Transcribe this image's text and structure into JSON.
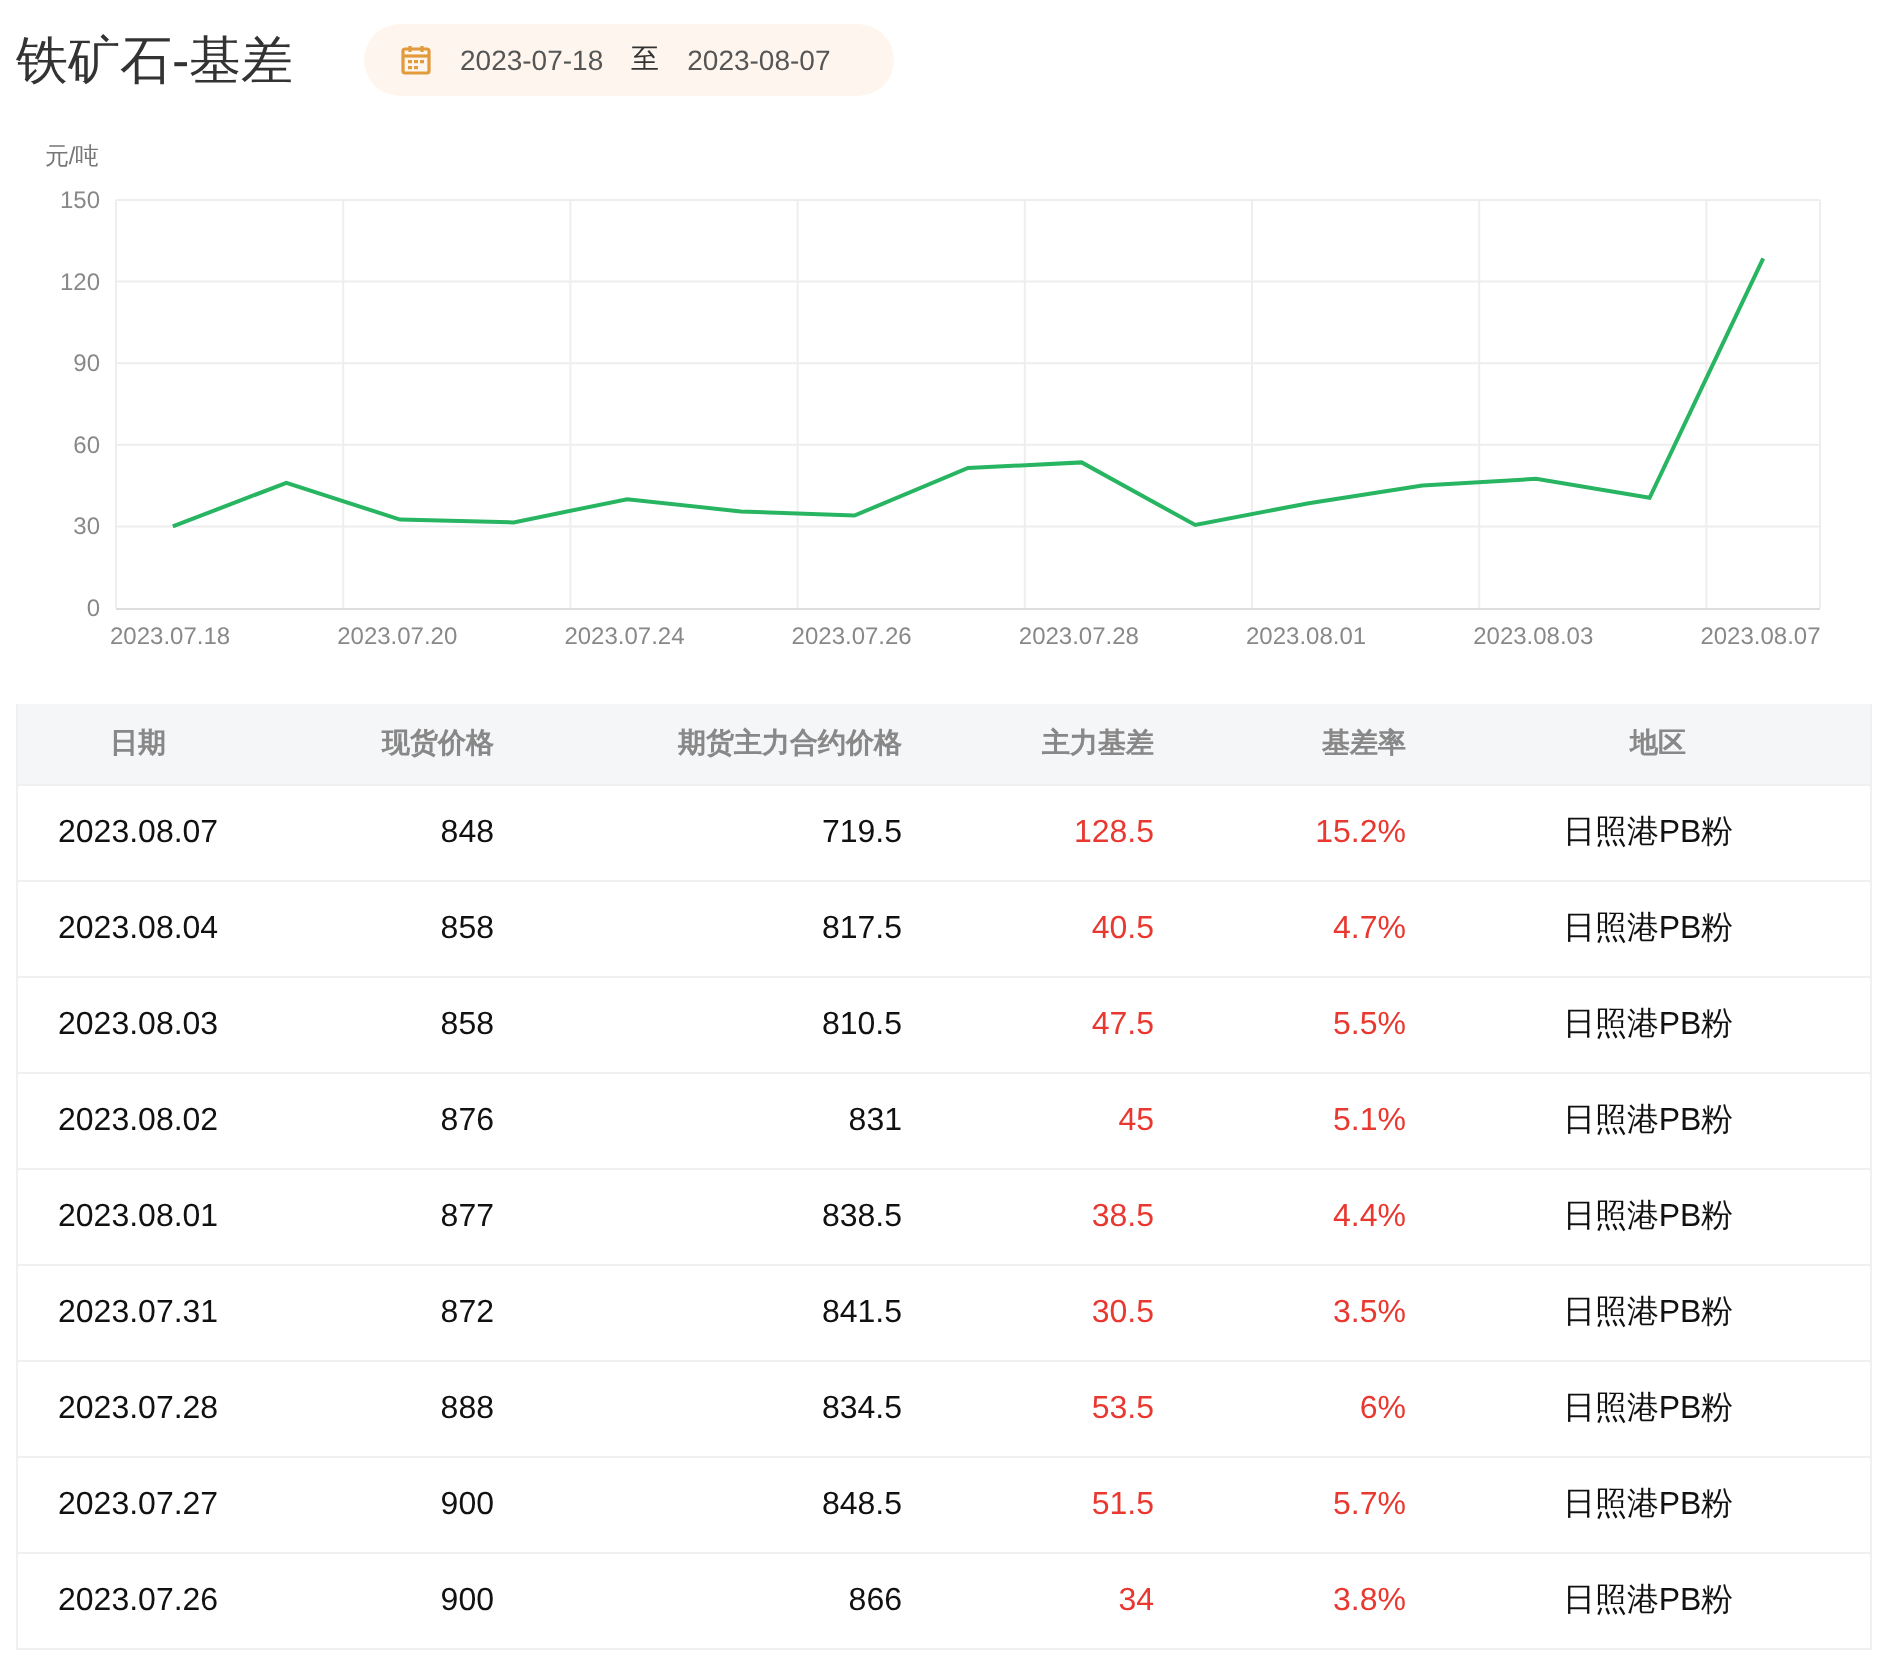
{
  "title": "铁矿石-基差",
  "date_range": {
    "start": "2023-07-18",
    "separator": "至",
    "end": "2023-08-07"
  },
  "chart": {
    "unit": "元/吨",
    "chart_data": {
      "type": "line",
      "categories": [
        "2023.07.18",
        null,
        "2023.07.20",
        null,
        "2023.07.24",
        null,
        "2023.07.26",
        null,
        "2023.07.28",
        null,
        "2023.08.01",
        null,
        "2023.08.03",
        null,
        "2023.08.07"
      ],
      "series": [
        {
          "color": "#27b562",
          "values": [
            30,
            46,
            32.5,
            31.5,
            40,
            35.5,
            34,
            51.5,
            53.5,
            30.5,
            38.5,
            45,
            47.5,
            40.5,
            128.5
          ]
        }
      ],
      "grid": true,
      "ylim": [
        0,
        150
      ],
      "yticks": [
        0,
        30,
        60,
        90,
        120,
        150
      ]
    }
  },
  "table": {
    "columns": [
      "日期",
      "现货价格",
      "期货主力合约价格",
      "主力基差",
      "基差率",
      "地区"
    ],
    "rows": [
      [
        "2023.08.07",
        "848",
        "719.5",
        "128.5",
        "15.2%",
        "日照港PB粉"
      ],
      [
        "2023.08.04",
        "858",
        "817.5",
        "40.5",
        "4.7%",
        "日照港PB粉"
      ],
      [
        "2023.08.03",
        "858",
        "810.5",
        "47.5",
        "5.5%",
        "日照港PB粉"
      ],
      [
        "2023.08.02",
        "876",
        "831",
        "45",
        "5.1%",
        "日照港PB粉"
      ],
      [
        "2023.08.01",
        "877",
        "838.5",
        "38.5",
        "4.4%",
        "日照港PB粉"
      ],
      [
        "2023.07.31",
        "872",
        "841.5",
        "30.5",
        "3.5%",
        "日照港PB粉"
      ],
      [
        "2023.07.28",
        "888",
        "834.5",
        "53.5",
        "6%",
        "日照港PB粉"
      ],
      [
        "2023.07.27",
        "900",
        "848.5",
        "51.5",
        "5.7%",
        "日照港PB粉"
      ],
      [
        "2023.07.26",
        "900",
        "866",
        "34",
        "3.8%",
        "日照港PB粉"
      ]
    ]
  }
}
